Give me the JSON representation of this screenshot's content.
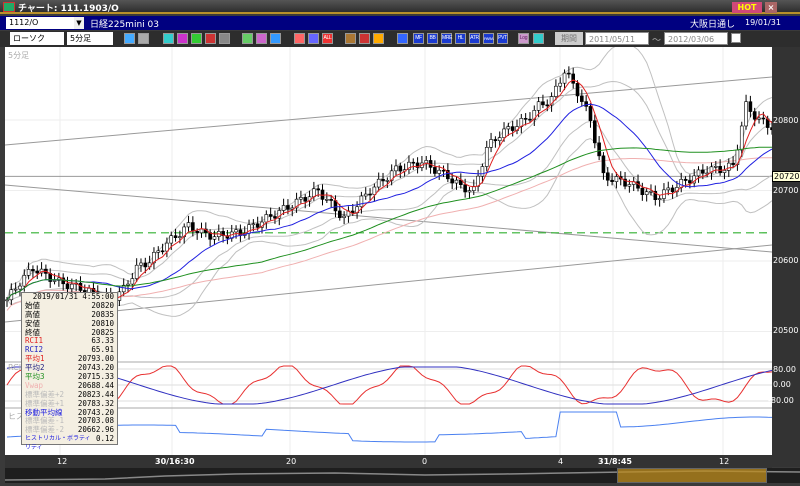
{
  "window": {
    "title": "チャート: 111.1903/O",
    "hot_label": "HOT",
    "close_label": "×"
  },
  "nav": {
    "code": "1112/O",
    "instrument": "日経225mini 03",
    "session": "大阪日通し",
    "date": "19/01/31"
  },
  "toolbar": {
    "chart_type": "ローソク",
    "interval": "5分足",
    "period_button": "期間",
    "date_from": "2011/05/11",
    "date_to": "2012/03/06",
    "tilde": "〜",
    "buttons": [
      "search",
      "grid",
      "b1",
      "b2",
      "b3",
      "b4",
      "b5",
      "draw",
      "cursor",
      "arrow",
      "o1",
      "o2",
      "ALL",
      "gear",
      "pen",
      "color",
      "indicator",
      "MF",
      "BB",
      "MRE",
      "HL",
      "ATR",
      "PARA",
      "PVT",
      "Log",
      "export"
    ]
  },
  "chart": {
    "pane_label": "5分足",
    "rci_label": "RCI",
    "hist_label": "ヒストリカル",
    "price_ticks": [
      "20800",
      "20700",
      "20600",
      "20500"
    ],
    "current_price": "20720",
    "rci_ticks": [
      "80.00",
      "0.00",
      "-80.00"
    ],
    "x_ticks": [
      "12",
      "30/16:30",
      "20",
      "0",
      "4",
      "31/8:45",
      "12"
    ],
    "colors": {
      "ma1": "#e02020",
      "ma2": "#2020e0",
      "ma3": "#209020",
      "vwap": "#f0b0b0",
      "band": "#c0c0c0",
      "rci1": "#e83030",
      "rci2": "#3030c0",
      "hist": "#4a80f0",
      "dash": "#30b030"
    }
  },
  "chart_data": {
    "type": "candlestick",
    "xlabel": "",
    "ylabel": "",
    "ylim": [
      20460,
      20900
    ],
    "closes": [
      20545,
      20570,
      20590,
      20580,
      20570,
      20565,
      20560,
      20550,
      20545,
      20560,
      20590,
      20600,
      20620,
      20635,
      20650,
      20640,
      20635,
      20638,
      20640,
      20650,
      20660,
      20670,
      20680,
      20690,
      20700,
      20680,
      20660,
      20680,
      20700,
      20715,
      20730,
      20735,
      20740,
      20730,
      20720,
      20705,
      20700,
      20760,
      20780,
      20790,
      20800,
      20820,
      20830,
      20870,
      20840,
      20800,
      20720,
      20715,
      20710,
      20700,
      20690,
      20700,
      20710,
      20720,
      20730,
      20730,
      20735,
      20820,
      20800,
      20790
    ],
    "horizontal_line": 20720,
    "dashed_line": 20640
  },
  "info": {
    "datetime": "2019/01/31 4:55:00",
    "rows": [
      {
        "label": "始値",
        "value": "20820",
        "color": "#000"
      },
      {
        "label": "高値",
        "value": "20835",
        "color": "#000"
      },
      {
        "label": "安値",
        "value": "20810",
        "color": "#000"
      },
      {
        "label": "終値",
        "value": "20825",
        "color": "#000"
      },
      {
        "label": "RCI1",
        "value": "63.33",
        "color": "#e02020"
      },
      {
        "label": "RCI2",
        "value": "65.91",
        "color": "#2020c0"
      },
      {
        "label": "平均1",
        "value": "20793.00",
        "color": "#e02020"
      },
      {
        "label": "平均2",
        "value": "20743.20",
        "color": "#202080"
      },
      {
        "label": "平均3",
        "value": "20715.33",
        "color": "#209020"
      },
      {
        "label": "Vwap",
        "value": "20688.44",
        "color": "#f0b0b0"
      },
      {
        "label": "標準偏差+2",
        "value": "20823.44",
        "color": "#bbb"
      },
      {
        "label": "標準偏差+1",
        "value": "20783.32",
        "color": "#bbb"
      },
      {
        "label": "移動平均線",
        "value": "20743.20",
        "color": "#2020e0"
      },
      {
        "label": "標準偏差-1",
        "value": "20703.08",
        "color": "#bbb"
      },
      {
        "label": "標準偏差-2",
        "value": "20662.96",
        "color": "#bbb"
      },
      {
        "label": "ヒストリカル・ボラティリティ",
        "value": "0.12",
        "color": "#2020e0"
      }
    ]
  }
}
